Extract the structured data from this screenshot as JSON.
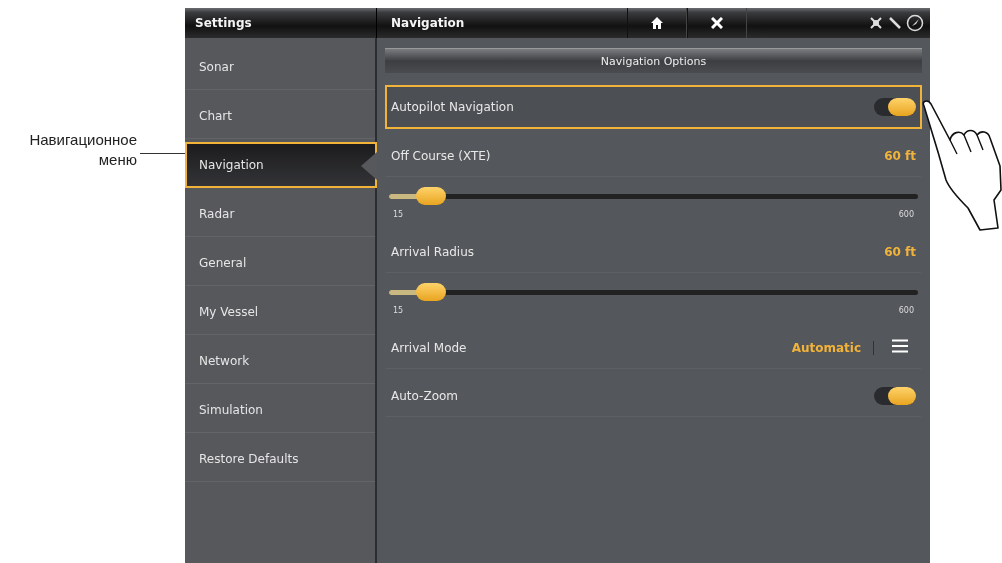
{
  "callout": {
    "text": "Навигационное меню"
  },
  "header": {
    "left_title": "Settings",
    "right_title": "Navigation"
  },
  "sidebar": {
    "items": [
      {
        "label": "Sonar",
        "selected": false
      },
      {
        "label": "Chart",
        "selected": false
      },
      {
        "label": "Navigation",
        "selected": true
      },
      {
        "label": "Radar",
        "selected": false
      },
      {
        "label": "General",
        "selected": false
      },
      {
        "label": "My Vessel",
        "selected": false
      },
      {
        "label": "Network",
        "selected": false
      },
      {
        "label": "Simulation",
        "selected": false
      },
      {
        "label": "Restore Defaults",
        "selected": false
      }
    ]
  },
  "panel": {
    "section_title": "Navigation Options",
    "rows": [
      {
        "kind": "toggle",
        "label": "Autopilot Navigation",
        "on": true,
        "selected": true
      },
      {
        "kind": "value",
        "label": "Off Course (XTE)",
        "value": "60 ft",
        "selected": false
      },
      {
        "kind": "slider",
        "level": 0.08,
        "min_label": "15",
        "max_label": "600"
      },
      {
        "kind": "value",
        "label": "Arrival Radius",
        "value": "60 ft",
        "selected": false
      },
      {
        "kind": "slider",
        "level": 0.08,
        "min_label": "15",
        "max_label": "600"
      },
      {
        "kind": "menu",
        "label": "Arrival Mode",
        "value": "Automatic",
        "selected": false
      },
      {
        "kind": "toggle",
        "label": "Auto-Zoom",
        "on": true,
        "selected": false
      }
    ]
  }
}
